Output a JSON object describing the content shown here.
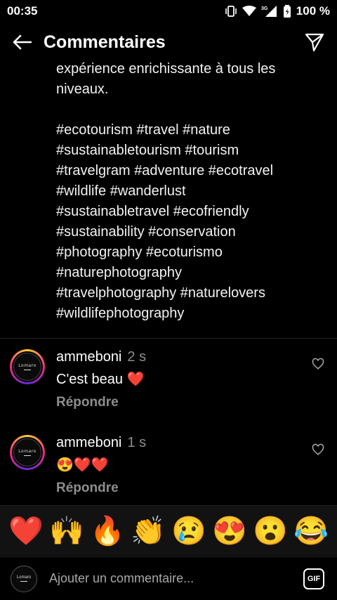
{
  "status_bar": {
    "time": "00:35",
    "battery": "100 %",
    "network": "3G",
    "icons": [
      "vibrate-icon",
      "wifi-icon",
      "signal-icon",
      "battery-icon"
    ]
  },
  "header": {
    "title": "Commentaires",
    "back_icon": "arrow-left-icon",
    "send_icon": "paper-plane-icon"
  },
  "caption": {
    "lines": [
      "expérience enrichissante à tous les",
      "niveaux.",
      "",
      "#ecotourism #travel #nature",
      "#sustainabletourism #tourism",
      "#travelgram #adventure #ecotravel",
      "#wildlife #wanderlust",
      "#sustainabletravel #ecofriendly",
      "#sustainability #conservation",
      "#photography #ecoturismo",
      "#naturephotography",
      "#travelphotography #naturelovers",
      "#wildlifephotography"
    ]
  },
  "comments": [
    {
      "user": "ammeboni",
      "time": "2 s",
      "text": "C'est beau ❤️",
      "reply_label": "Répondre",
      "like_icon": "heart-outline-icon"
    },
    {
      "user": "ammeboni",
      "time": "1 s",
      "text": "😍❤️❤️",
      "reply_label": "Répondre",
      "like_icon": "heart-outline-icon"
    }
  ],
  "avatar_logo_text": "Lomaro",
  "emoji_bar": [
    "❤️",
    "🙌",
    "🔥",
    "👏",
    "😢",
    "😍",
    "😮",
    "😂"
  ],
  "composer": {
    "placeholder": "Ajouter un commentaire...",
    "gif_label": "GIF"
  },
  "colors": {
    "background": "#000000",
    "secondary_text": "#8e8e8e",
    "emoji_bar_bg": "#121212"
  }
}
